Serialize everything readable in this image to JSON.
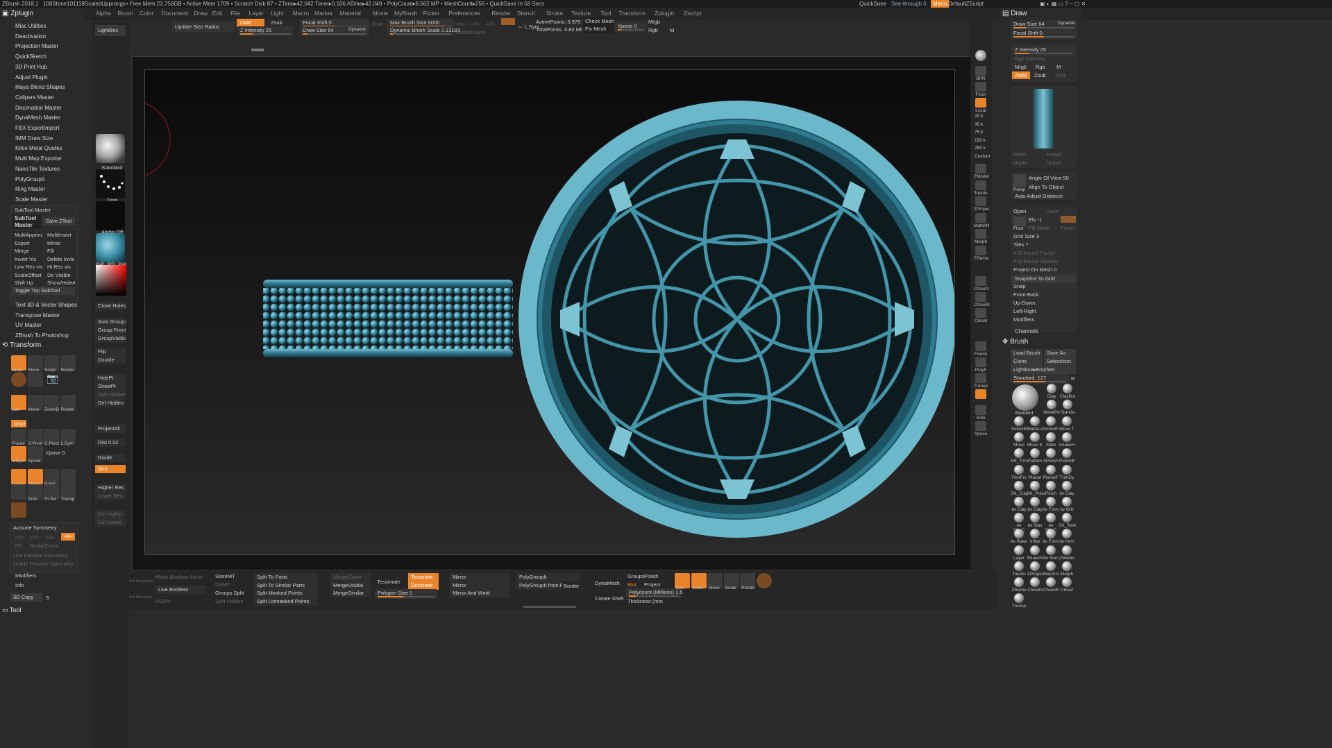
{
  "titlebar": {
    "app": "ZBrush 2018.1",
    "doc": "108Stone101118ScaledUpprongs",
    "status": "• Free Mem 23.756GB • Active Mem 1709 • Scratch Disk 87 • ZTime▸42.042 Timer▸0.106 ATime▸42.049 • PolyCount▸6.562 MP • MeshCount▸256 • QuickSave In 58 Secs",
    "quicksave": "QuickSave",
    "see_through": "See-through  0",
    "menu_btn": "Menu",
    "default_zscript": "DefaultZScript"
  },
  "menubar": [
    "Alpha",
    "Brush",
    "Color",
    "Document",
    "Draw",
    "Edit",
    "File",
    "Layer",
    "Light",
    "Macro",
    "Marker",
    "Material",
    "Movie",
    "MyBrush",
    "Picker",
    "Preferences",
    "Render",
    "Stencil",
    "Stroke",
    "Texture",
    "Tool",
    "Transform",
    "Zplugin",
    "Zscript"
  ],
  "top_toolbar": {
    "lightbox": "LightBox",
    "update_size_ratios": "Update Size Ratios",
    "zadd": "Zadd",
    "zsub": "Zsub",
    "zcut": "Zcut",
    "z_intensity": "Z Intensity 25",
    "focal_shift": "Focal Shift 0",
    "draw_size": "Draw Size 64",
    "dynamic": "Dynamic",
    "max_brush_size": "Max Brush Size 5000",
    "dynamic_brush_scale": "Dynamic Brush Scale 2.13183",
    "radial_count": "RadialCount",
    "active_points": "ActivePoints: 3.979 Mil",
    "total_points": "TotalPoints: 4.83 Mil",
    "check_mesh": "Check Mesh In",
    "fix_mesh": "Fix Mesh",
    "xpose": "Xpose 0",
    "mrgb": "Mrgb",
    "rgb": "Rgb",
    "m": "M",
    "lsym": "L.Sym",
    "x": ">X<",
    "y": ">Y<",
    "z": ">Z<"
  },
  "left_panel": {
    "zplugin_title": "Zplugin",
    "plugins": [
      "Misc Utilities",
      "Deactivation",
      "Projection Master",
      "QuickSketch",
      "3D Print Hub",
      "Adjust Plugin",
      "Maya Blend Shapes",
      "Calipers Master",
      "Decimation Master",
      "DynaMesh Master",
      "FBX ExportImport",
      "IMM Draw Size",
      "Kitco Metal Quotes",
      "Multi Map Exporter",
      "NanoTile Textures",
      "PolyGroupIt",
      "Ring Master",
      "Scale Master"
    ],
    "subtool_master": {
      "header": "SubTool Master",
      "big": "SubTool Master",
      "save_ztool": "Save ZTool",
      "rows": [
        [
          "MultiAppend",
          "MultiInsert"
        ],
        [
          "Export",
          "Mirror"
        ],
        [
          "Merge",
          "Fill"
        ],
        [
          "Invert Vis",
          "Delete Invis"
        ],
        [
          "Low Res vis",
          "Hi Res vis"
        ],
        [
          "ScaleOffset",
          "Do Visible"
        ],
        [
          "Shift Up",
          "Show/HideAll"
        ]
      ],
      "toggle_top": "Toggle Top SubTool"
    },
    "more_plugins": [
      "Text 3D & Vector Shapes",
      "Transpose Master",
      "UV Master",
      "ZBrush To Photoshop"
    ],
    "transform_title": "Transform",
    "transform_icons": [
      "Draw",
      "Move",
      "Scale",
      "Rotate"
    ],
    "edit_icons": [
      "Edit",
      "Move",
      "ZoomD",
      "Rotate"
    ],
    "xyz": "Qxyz",
    "frame_icons": [
      "Frame",
      "S.Pivot",
      "C.Pivot",
      "L.Sym"
    ],
    "vsym": "V.Sym",
    "xpose_l": "Xpose",
    "xpose_val": "Xpose 0",
    "local_icons": [
      "Local",
      "Quick",
      "PolyF",
      ""
    ],
    "solo_icons": [
      "",
      "Solo",
      "Pt Sel",
      "Transp"
    ],
    "activate_symmetry": "Activate Symmetry",
    "sym_x": ">X<",
    "sym_y": ">Y<",
    "sym_z": ">Z<",
    "sym_m": ">M<",
    "sym_r": "(R)",
    "radial_count": "RadialCount",
    "use_posable": "Use Posable Symmetry",
    "delete_posable": "Delete Posable Symmetry",
    "modifiers": "Modifiers",
    "info": "Info",
    "copy3d": "3D Copy",
    "copy3d_s": "S",
    "tool_title": "Tool"
  },
  "shelf": {
    "standard": "Standard",
    "dots": "Dots",
    "alpha_off": "Alpha Off",
    "material": "mah_dirty_blue",
    "close_holes": "Close Holes",
    "auto_groups": "Auto Groups",
    "group_front": "Group Front",
    "group_visible": "GroupVisible",
    "flip": "Flip",
    "double": "Double",
    "hidept": "HidePt",
    "showpt": "ShowPt",
    "split_hidden": "Split Hidden",
    "del_hidden": "Del Hidden",
    "project_all": "ProjectAll",
    "dist": "Dist 0.02",
    "divide": "Divide",
    "smt": "Smt",
    "higher_res": "Higher Res",
    "lower_res": "Lower Res",
    "del_higher": "Del Higher",
    "del_lower": "Del Lower"
  },
  "right_tray": {
    "bpr": "BPR",
    "floor": "Floor",
    "local": "Local",
    "counts": [
      "20 k",
      "35 k",
      "75 k",
      "150 k",
      "250 k",
      "Custom"
    ],
    "items": [
      "ZModel",
      "Topolo",
      "ZProjec",
      "MatchN",
      "Morph",
      "ZReme",
      "Chisel3",
      "ChiselR",
      "Chisel"
    ],
    "nav": [
      "Frame",
      "PolyF",
      "Transp",
      "",
      "Solo",
      "Xpose"
    ]
  },
  "draw_panel": {
    "title": "Draw",
    "draw_size": "Draw Size 64",
    "dynamic": "Dynamic",
    "focal_shift": "Focal Shift 0",
    "z_intensity": "Z Intensity 25",
    "rgb_intensity": "Rgb Intensity",
    "mrgb": "Mrgb",
    "rgb": "Rgb",
    "m": "M",
    "zadd": "Zadd",
    "zsub": "Zsub",
    "zcut": "Zcut",
    "width": "Width",
    "height": "Height",
    "depth": "Depth",
    "imbed": "Imbed",
    "persp": "Persp",
    "angle_of_view": "Angle Of View 50",
    "align_to_object": "Align To Object",
    "auto_adjust_distance": "Auto Adjust Distance",
    "open": "Open",
    "save": "Save",
    "floor": "Floor",
    "elv": "Elv -1",
    "fill_mode": "Fill Mode",
    "front": "Front",
    "grid_size": "Grid Size 3",
    "tiles": "Tiles 7",
    "x_enhance": "X Enhance Factor",
    "x_enhance_opacity": "X Enhance Opacity",
    "project_on_mesh": "Project On Mesh 0",
    "snapshot": "Snapshot To Grid",
    "items": [
      "Snap",
      "Front-Back",
      "Up-Down",
      "Left-Right",
      "Modifiers"
    ],
    "channels": "Channels"
  },
  "brush_panel": {
    "title": "Brush",
    "load_brush": "Load Brush",
    "save_as": "Save As",
    "clone": "Clone",
    "select_icon": "SelectIcon",
    "lightbox_brushes": "Lightbox▸Brushes",
    "standard_val": "Standard. 127",
    "r": "R",
    "standard": "Standard",
    "top_brushes": [
      "Clay",
      "ClayBui",
      "MaskPe",
      "Standa"
    ],
    "grid": [
      "SelectR",
      "MaskLa",
      "Smooth",
      "Move T",
      "Move",
      "Move E",
      "Slide",
      "SnakeH",
      "SK_Trim",
      "Flatten",
      "hPolish",
      "PolishB",
      "TrimFrc",
      "Planar",
      "PlanarF",
      "TrimDy",
      "SK_Clay",
      "SK_Polis",
      "Pinch",
      "tw Clay",
      "tw Clay",
      "tw Clay",
      "tw Form",
      "tw Orb",
      "tw SK_C",
      "tw Slas",
      "tw SK_C",
      "SK_Twin",
      "tw Rake",
      "Inflat",
      "tw Form",
      "tw form",
      "Layer",
      "SnakeH",
      "tw Stan",
      "ZModel",
      "Topolo",
      "ZProjec",
      "MatchN",
      "Morph",
      "ZReme",
      "Chisel3",
      "ChiselR",
      "Chisel",
      "Transp"
    ]
  },
  "bottom_bar": {
    "col1": [
      "Make Boolean Mesh",
      "Live Boolean",
      "DSDiv"
    ],
    "col0": [
      "ew Expressi",
      "ew Bessels"
    ],
    "store_mt": "StoreMT",
    "del_mt": "DelMT",
    "groups_split": "Groups Split",
    "split_hidden": "Split Hidden",
    "split": [
      "Split To Parts",
      "Split To Similar Parts",
      "Split Masked Points",
      "Split Unmasked Points"
    ],
    "merge": [
      "MergeDown",
      "MergeVisible",
      "MergeSimilar"
    ],
    "tessimate": "Tessimate",
    "tesselate": "Tesselate",
    "decimate": "Decimate",
    "polygon_size": "Polygon Size 1",
    "mirror": [
      "Mirror",
      "Mirror",
      "Mirror And Weld"
    ],
    "polygroupit": "PolyGroupIt",
    "polygroupit_paint": "PolyGroupIt from Pai",
    "border": "Border",
    "dynamesh": "DynaMesh",
    "groups": "Groups",
    "polish": "Polish",
    "blur": "Blur",
    "project": "Project",
    "polycount": "Polycount (Millions) 1.5",
    "create_shell": "Create Shell",
    "thickness": "Thickness (mm",
    "tool_icons": [
      "Edit",
      "Draw",
      "Move",
      "Scale",
      "Rotate"
    ]
  },
  "colors": {
    "accent": "#e9842a",
    "model": "#3a8fa6",
    "bg": "#2b2b2b"
  }
}
